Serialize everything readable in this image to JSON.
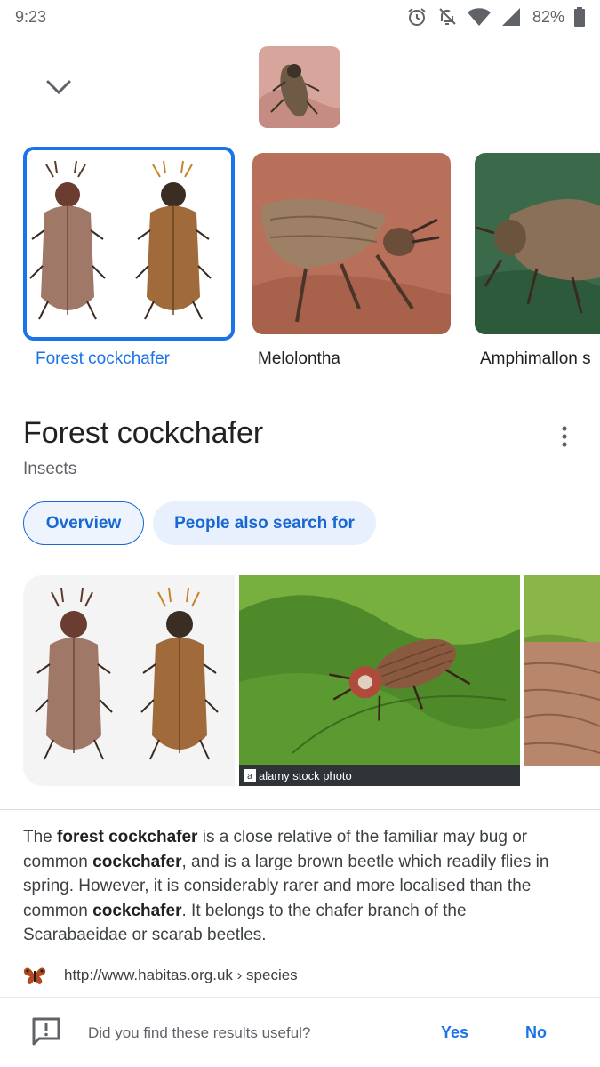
{
  "status_bar": {
    "time": "9:23",
    "battery": "82%"
  },
  "icons": {
    "alarm": "alarm-icon",
    "mute": "bell-off-icon",
    "wifi": "wifi-icon",
    "signal": "signal-icon",
    "battery": "battery-icon",
    "collapse": "chevron-down-icon",
    "more": "more-vert-icon",
    "feedback": "feedback-icon",
    "favicon": "butterfly-icon"
  },
  "entities": [
    {
      "label": "Forest cockchafer",
      "selected": true
    },
    {
      "label": "Melolontha",
      "selected": false
    },
    {
      "label": "Amphimallon s",
      "selected": false
    }
  ],
  "knowledge_panel": {
    "title": "Forest cockchafer",
    "subtitle": "Insects",
    "chips": [
      "Overview",
      "People also search for"
    ]
  },
  "images": [
    {
      "caption": ""
    },
    {
      "caption": "alamy stock photo"
    },
    {
      "caption": ""
    }
  ],
  "description": {
    "parts": [
      "The ",
      "forest cockchafer",
      " is a close relative of the familiar may bug or common ",
      "cockchafer",
      ", and is a large brown beetle which readily flies in spring. However, it is considerably rarer and more localised than the common ",
      "cockchafer",
      ". It belongs to the chafer branch of the Scarabaeidae or scarab beetles."
    ]
  },
  "source": {
    "url": "http://www.habitas.org.uk › species"
  },
  "feedback": {
    "question": "Did you find these results useful?",
    "yes": "Yes",
    "no": "No"
  },
  "colors": {
    "accent": "#1a73e8",
    "chip_bg": "#e8f0fe",
    "text": "#202124",
    "secondary": "#5f6368"
  }
}
